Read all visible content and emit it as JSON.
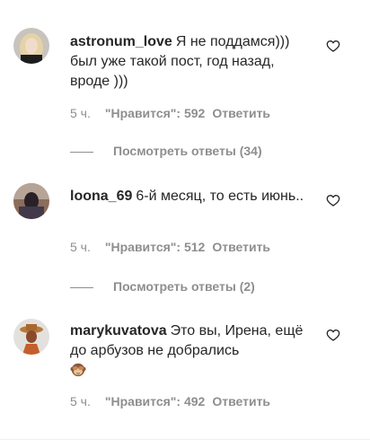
{
  "comments": [
    {
      "username": "astronum_love",
      "text": "Я не поддамся))) был уже такой пост, год назад, вроде )))",
      "time": "5 ч.",
      "likes": "\"Нравится\": 592",
      "reply": "Ответить",
      "view_replies": "Посмотреть ответы (34)"
    },
    {
      "username": "loona_69",
      "text": "6-й месяц, то есть июнь..",
      "time": "5 ч.",
      "likes": "\"Нравится\": 512",
      "reply": "Ответить",
      "view_replies": "Посмотреть ответы (2)"
    },
    {
      "username": "marykuvatova",
      "text": "Это вы, Ирена, ещё до арбузов не добрались",
      "emoji": "see-no-evil-monkey",
      "time": "5 ч.",
      "likes": "\"Нравится\": 492",
      "reply": "Ответить"
    }
  ],
  "icons": {
    "like": "heart-outline-icon"
  },
  "colors": {
    "text": "#262626",
    "secondary": "#8e8e8e"
  }
}
